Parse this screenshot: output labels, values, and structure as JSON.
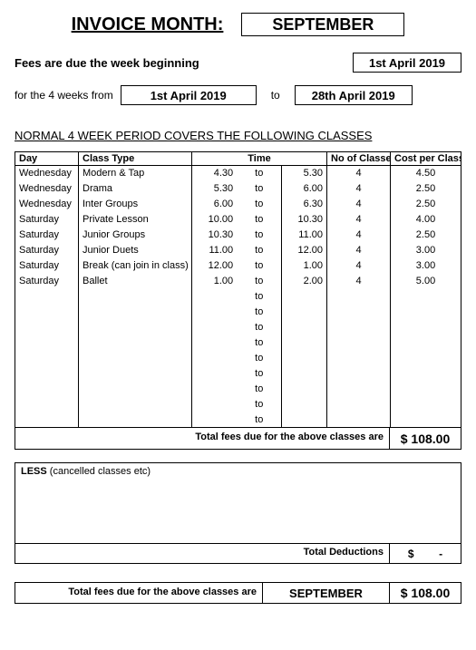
{
  "header": {
    "title": "INVOICE MONTH:",
    "month": "SEPTEMBER",
    "due_text": "Fees are due the week beginning",
    "due_date": "1st April 2019",
    "weeks_text": "for the 4 weeks from",
    "from_date": "1st April 2019",
    "to_word": "to",
    "to_date": "28th April 2019"
  },
  "section_title": "NORMAL 4 WEEK PERIOD COVERS THE FOLLOWING CLASSES",
  "table": {
    "headers": {
      "day": "Day",
      "type": "Class Type",
      "time": "Time",
      "num": "No of Classes",
      "cost": "Cost per Class"
    },
    "rows": [
      {
        "day": "Wednesday",
        "type": "Modern & Tap",
        "t1": "4.30",
        "to": "to",
        "t2": "5.30",
        "num": "4",
        "cost": "4.50"
      },
      {
        "day": "Wednesday",
        "type": "Drama",
        "t1": "5.30",
        "to": "to",
        "t2": "6.00",
        "num": "4",
        "cost": "2.50"
      },
      {
        "day": "Wednesday",
        "type": "Inter Groups",
        "t1": "6.00",
        "to": "to",
        "t2": "6.30",
        "num": "4",
        "cost": "2.50"
      },
      {
        "day": "Saturday",
        "type": "Private Lesson",
        "t1": "10.00",
        "to": "to",
        "t2": "10.30",
        "num": "4",
        "cost": "4.00"
      },
      {
        "day": "Saturday",
        "type": "Junior Groups",
        "t1": "10.30",
        "to": "to",
        "t2": "11.00",
        "num": "4",
        "cost": "2.50"
      },
      {
        "day": "Saturday",
        "type": "Junior Duets",
        "t1": "11.00",
        "to": "to",
        "t2": "12.00",
        "num": "4",
        "cost": "3.00"
      },
      {
        "day": "Saturday",
        "type": "Break (can join in class)",
        "t1": "12.00",
        "to": "to",
        "t2": "1.00",
        "num": "4",
        "cost": "3.00"
      },
      {
        "day": "Saturday",
        "type": "Ballet",
        "t1": "1.00",
        "to": "to",
        "t2": "2.00",
        "num": "4",
        "cost": "5.00"
      },
      {
        "day": "",
        "type": "",
        "t1": "",
        "to": "to",
        "t2": "",
        "num": "",
        "cost": ""
      },
      {
        "day": "",
        "type": "",
        "t1": "",
        "to": "to",
        "t2": "",
        "num": "",
        "cost": ""
      },
      {
        "day": "",
        "type": "",
        "t1": "",
        "to": "to",
        "t2": "",
        "num": "",
        "cost": ""
      },
      {
        "day": "",
        "type": "",
        "t1": "",
        "to": "to",
        "t2": "",
        "num": "",
        "cost": ""
      },
      {
        "day": "",
        "type": "",
        "t1": "",
        "to": "to",
        "t2": "",
        "num": "",
        "cost": ""
      },
      {
        "day": "",
        "type": "",
        "t1": "",
        "to": "to",
        "t2": "",
        "num": "",
        "cost": ""
      },
      {
        "day": "",
        "type": "",
        "t1": "",
        "to": "to",
        "t2": "",
        "num": "",
        "cost": ""
      },
      {
        "day": "",
        "type": "",
        "t1": "",
        "to": "to",
        "t2": "",
        "num": "",
        "cost": ""
      },
      {
        "day": "",
        "type": "",
        "t1": "",
        "to": "to",
        "t2": "",
        "num": "",
        "cost": ""
      }
    ]
  },
  "totals": {
    "label": "Total fees due for the above classes are",
    "value": "$ 108.00"
  },
  "less": {
    "heading_bold": "LESS",
    "heading_rest": " (cancelled classes etc)",
    "deduct_label": "Total Deductions",
    "deduct_currency": "$",
    "deduct_value": "-"
  },
  "final": {
    "label": "Total fees due for the above classes are",
    "month": "SEPTEMBER",
    "value": "$ 108.00"
  }
}
